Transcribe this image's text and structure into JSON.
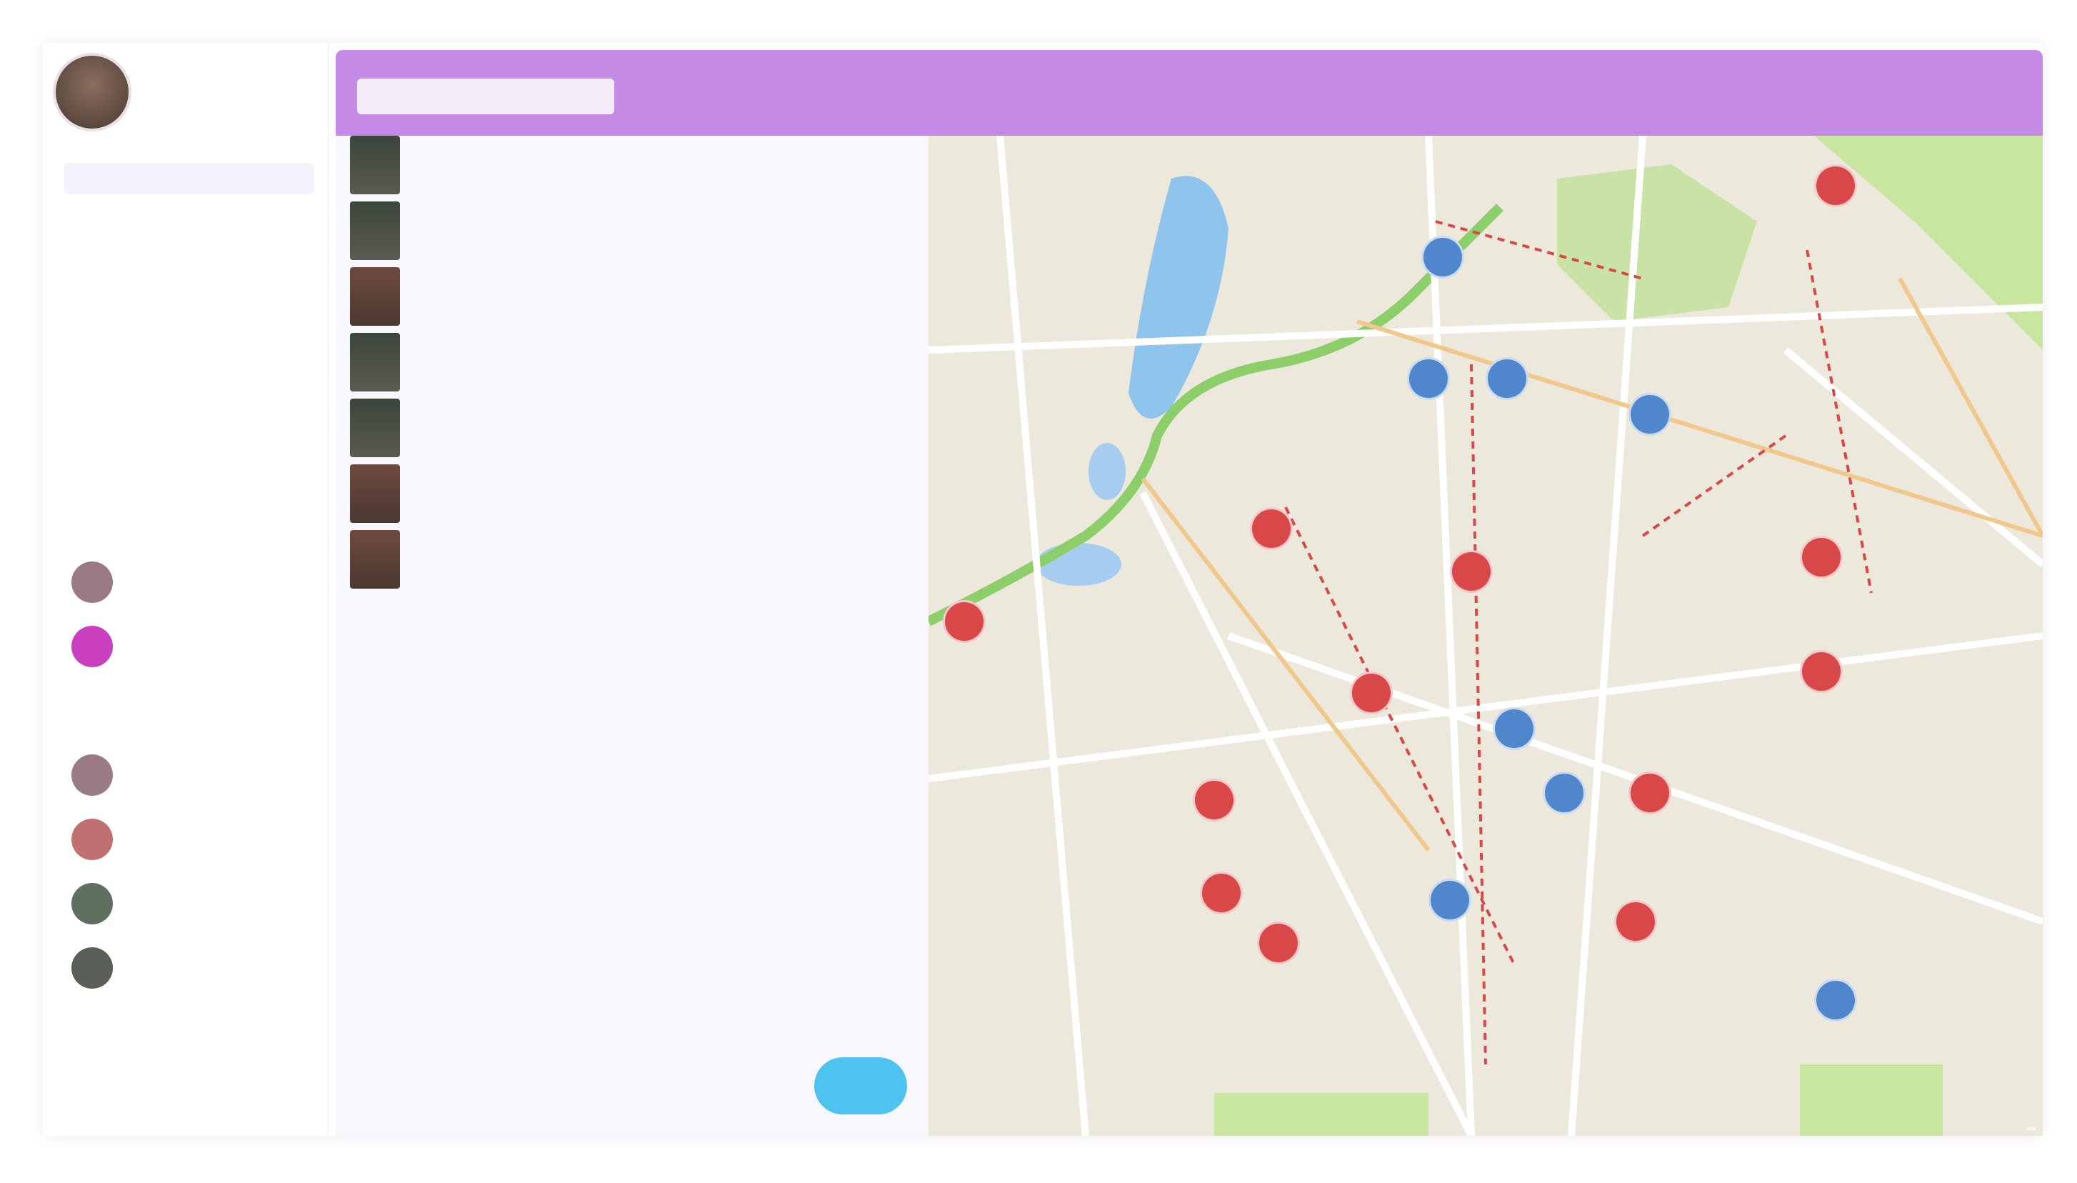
{
  "sidebar": {
    "profile": {
      "name": ""
    },
    "menu_header": "",
    "menu": [
      {
        "label": "",
        "active": true
      },
      {
        "label": "",
        "active": false
      },
      {
        "label": "",
        "active": false
      },
      {
        "label": "",
        "active": false
      },
      {
        "label": "",
        "active": false
      }
    ],
    "contacts_title": "",
    "contacts": [
      {
        "name": "",
        "color": "#9a7a86"
      },
      {
        "name": "",
        "color": "#c93fc0"
      },
      {
        "name": "",
        "color": "#ffffff"
      },
      {
        "name": "",
        "color": "#9a7a86"
      },
      {
        "name": "",
        "color": "#c07070"
      },
      {
        "name": "",
        "color": "#607060"
      },
      {
        "name": "",
        "color": "#5a5f58"
      },
      {
        "name": "",
        "color": "#ffffff"
      }
    ]
  },
  "topbar": {
    "search_placeholder": "",
    "color": "#c58ae6"
  },
  "list": {
    "rows": [
      {
        "title": "",
        "subtitle": ""
      },
      {
        "title": "",
        "subtitle": ""
      },
      {
        "title": "",
        "subtitle": ""
      },
      {
        "title": "",
        "subtitle": ""
      },
      {
        "title": "",
        "subtitle": ""
      },
      {
        "title": "",
        "subtitle": ""
      },
      {
        "title": "",
        "subtitle": ""
      }
    ],
    "compose_placeholder": "",
    "send_label": ""
  },
  "map": {
    "attribution": "",
    "marker_colors": {
      "red": "#d94848",
      "blue": "#4f86cc"
    }
  }
}
